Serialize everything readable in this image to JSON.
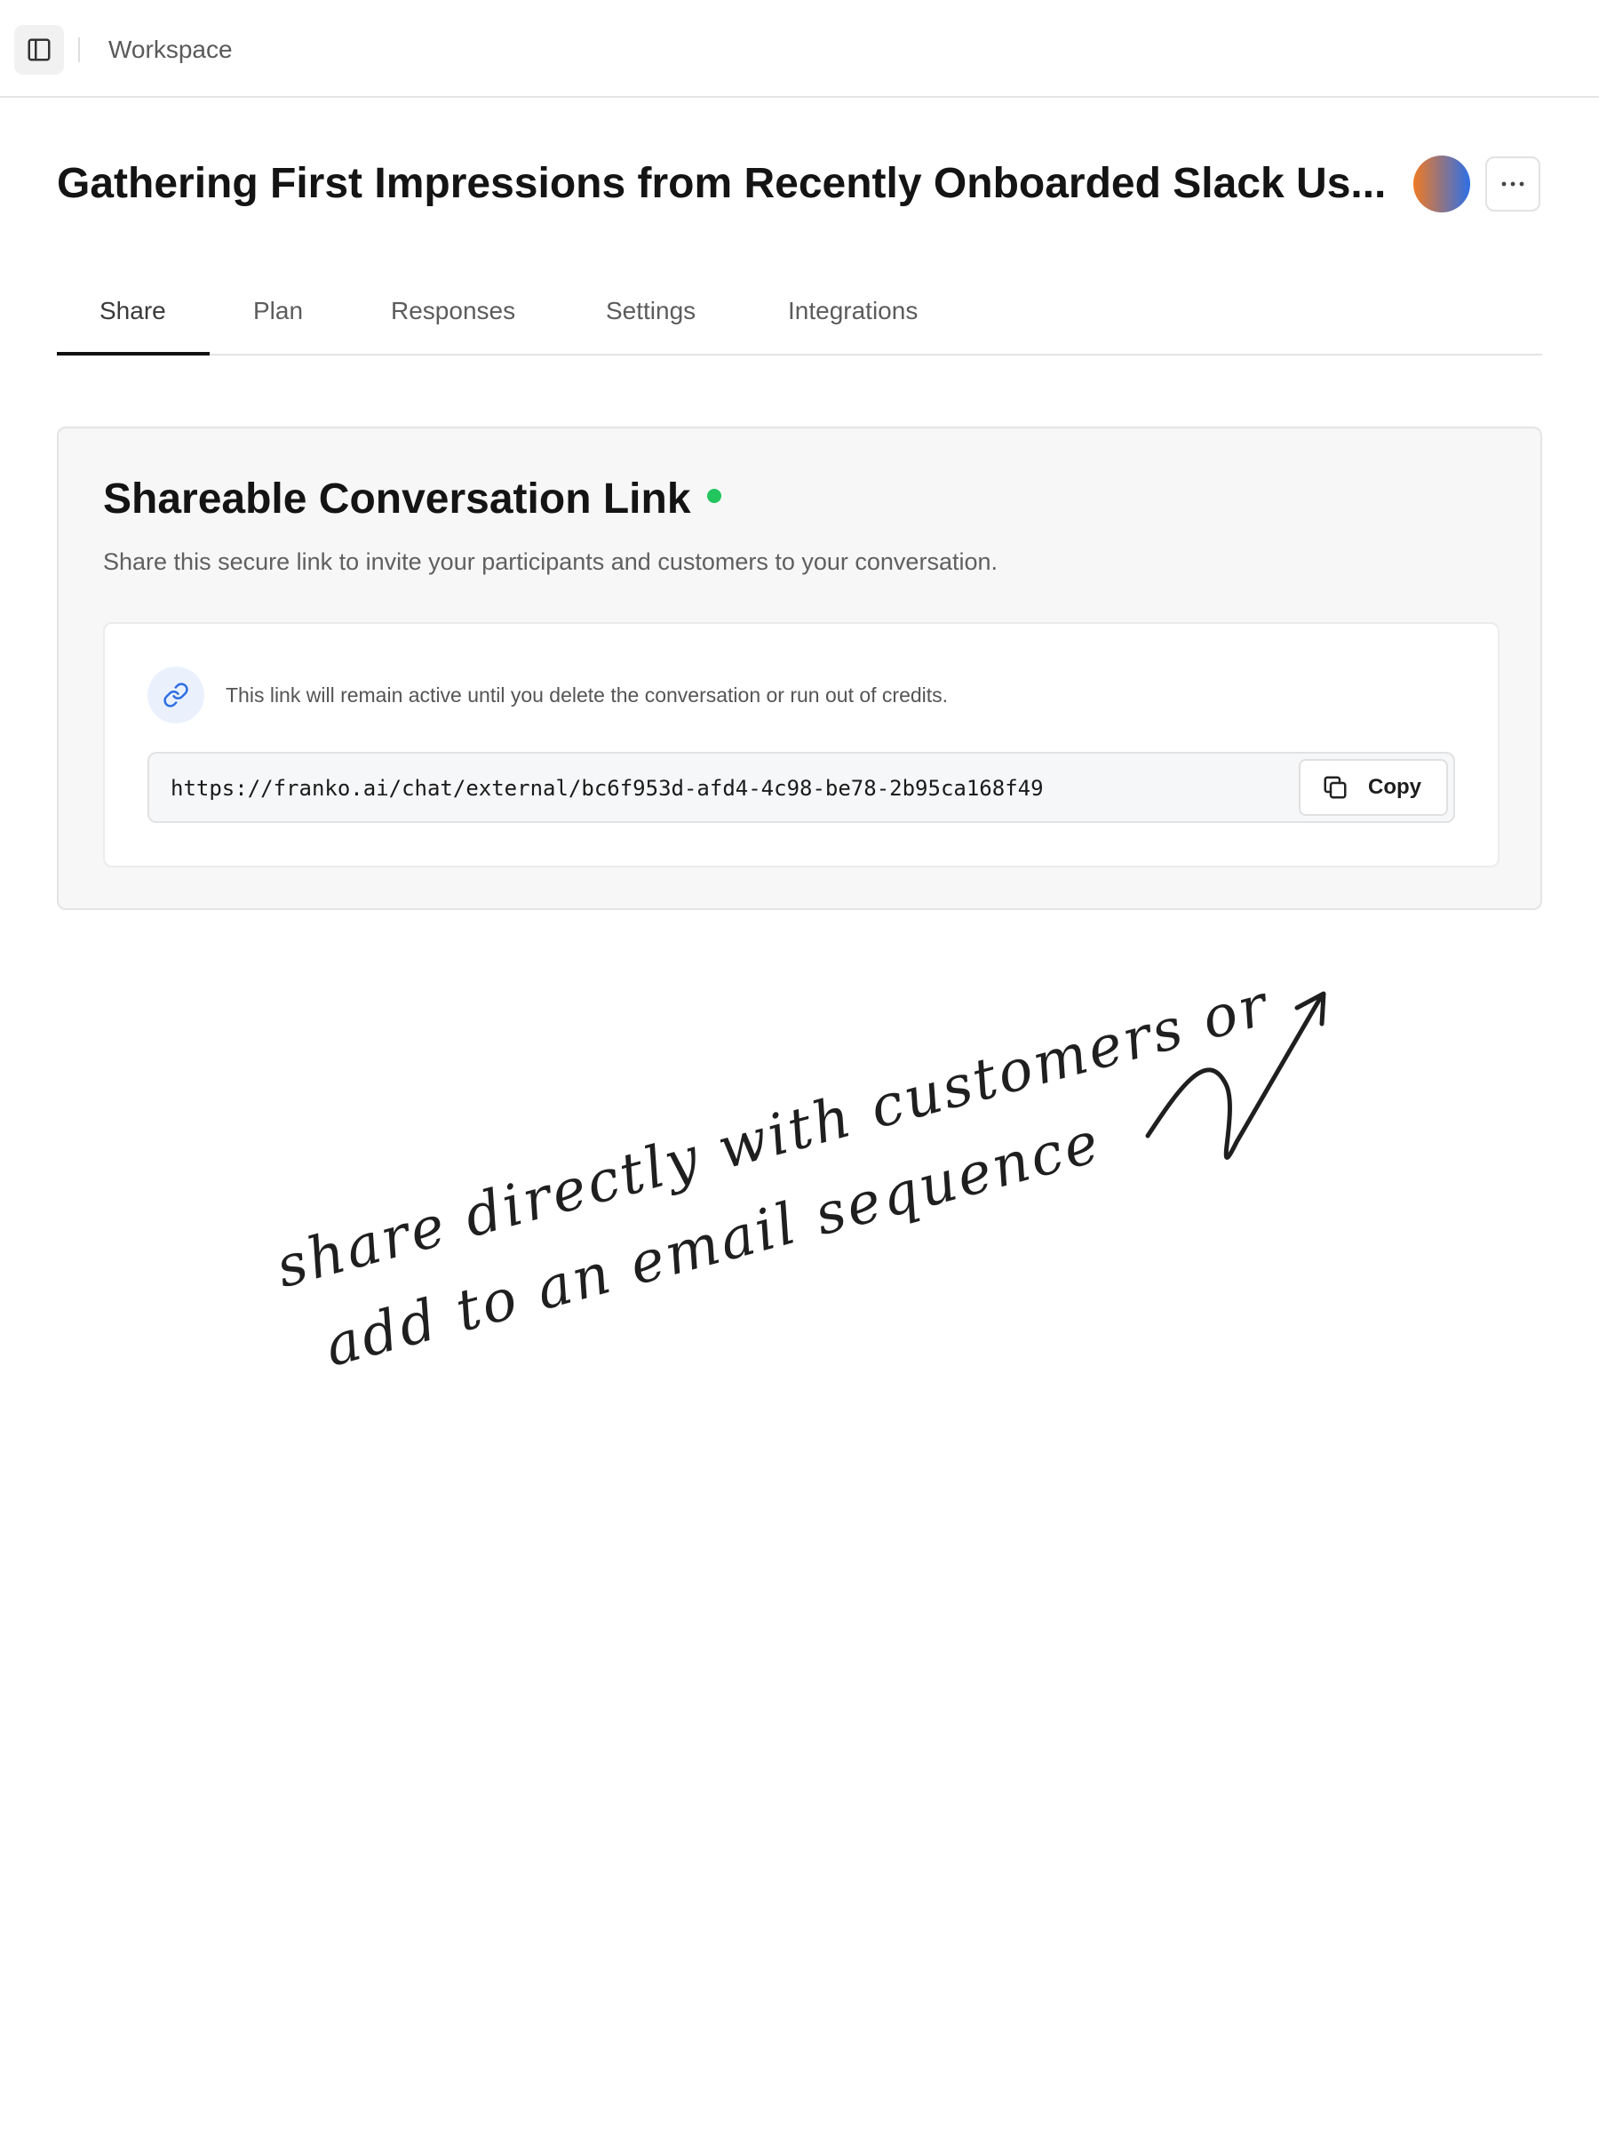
{
  "topbar": {
    "sidebar_toggle_icon": "sidebar-toggle-icon",
    "breadcrumb": "Workspace"
  },
  "header": {
    "title": "Gathering First Impressions from Recently Onboarded Slack Us...",
    "avatar_colors": [
      "#f07a24",
      "#2d6fe8"
    ],
    "more_icon": "more-horizontal-icon"
  },
  "tabs": [
    {
      "label": "Share",
      "active": true
    },
    {
      "label": "Plan",
      "active": false
    },
    {
      "label": "Responses",
      "active": false
    },
    {
      "label": "Settings",
      "active": false
    },
    {
      "label": "Integrations",
      "active": false
    }
  ],
  "share_card": {
    "title": "Shareable Conversation Link",
    "status_color": "#22c55e",
    "description": "Share this secure link to invite your participants and customers to your conversation.",
    "notice_icon": "link-icon",
    "notice": "This link will remain active until you delete the conversation or run out of credits.",
    "url": "https://franko.ai/chat/external/bc6f953d-afd4-4c98-be78-2b95ca168f49",
    "copy_icon": "copy-icon",
    "copy_label": "Copy"
  },
  "annotation": {
    "line1": "share directly with customers or",
    "line2": "add to an email sequence"
  }
}
